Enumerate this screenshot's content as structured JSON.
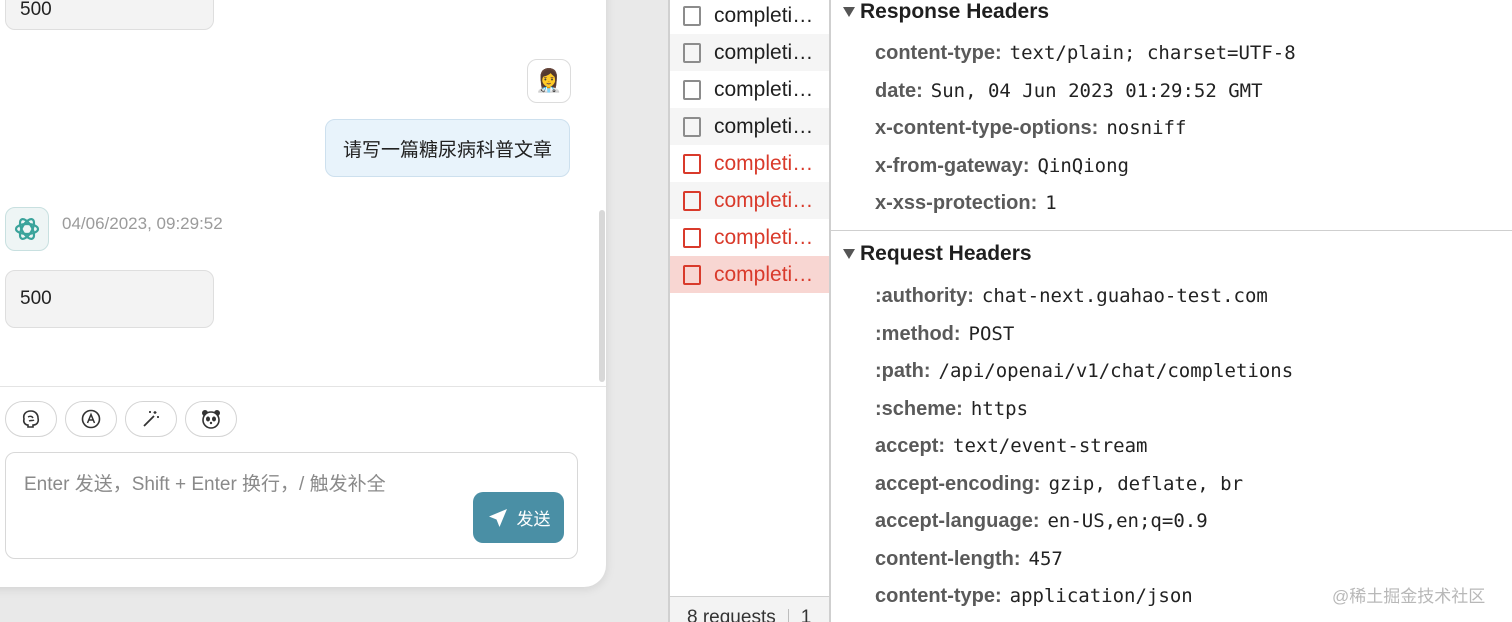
{
  "chat": {
    "top_bubble_text": "500",
    "user_avatar_emoji": "👩‍⚕️",
    "user_message": "请写一篇糖尿病科普文章",
    "bot_timestamp": "04/06/2023, 09:29:52",
    "bot_reply": "500",
    "toolbar": [
      {
        "icon": "brain-icon"
      },
      {
        "icon": "auto-icon"
      },
      {
        "icon": "magic-wand-icon"
      },
      {
        "icon": "panda-icon"
      }
    ],
    "input_placeholder": "Enter 发送，Shift + Enter 换行，/ 触发补全",
    "send_label": "发送",
    "colors": {
      "accent": "#4a8fa5",
      "user_bubble": "#e8f3fb"
    }
  },
  "network": {
    "requests": [
      {
        "name": "completi…",
        "status": "ok"
      },
      {
        "name": "completi…",
        "status": "ok"
      },
      {
        "name": "completi…",
        "status": "ok"
      },
      {
        "name": "completi…",
        "status": "ok"
      },
      {
        "name": "completi…",
        "status": "error"
      },
      {
        "name": "completi…",
        "status": "error"
      },
      {
        "name": "completi…",
        "status": "error"
      },
      {
        "name": "completi…",
        "status": "error",
        "selected": true
      }
    ],
    "footer": {
      "count": "8 requests",
      "extra": "1"
    },
    "colors": {
      "error": "#d93a2b",
      "selected_bg": "#f8d6d2"
    }
  },
  "headers": {
    "response_title": "Response Headers",
    "response": [
      {
        "name": "content-type:",
        "value": "text/plain; charset=UTF-8"
      },
      {
        "name": "date:",
        "value": "Sun, 04 Jun 2023 01:29:52 GMT"
      },
      {
        "name": "x-content-type-options:",
        "value": "nosniff"
      },
      {
        "name": "x-from-gateway:",
        "value": "QinQiong"
      },
      {
        "name": "x-xss-protection:",
        "value": "1"
      }
    ],
    "request_title": "Request Headers",
    "request": [
      {
        "name": ":authority:",
        "value": "chat-next.guahao-test.com"
      },
      {
        "name": ":method:",
        "value": "POST"
      },
      {
        "name": ":path:",
        "value": "/api/openai/v1/chat/completions"
      },
      {
        "name": ":scheme:",
        "value": "https"
      },
      {
        "name": "accept:",
        "value": "text/event-stream"
      },
      {
        "name": "accept-encoding:",
        "value": "gzip, deflate, br"
      },
      {
        "name": "accept-language:",
        "value": "en-US,en;q=0.9"
      },
      {
        "name": "content-length:",
        "value": "457"
      },
      {
        "name": "content-type:",
        "value": "application/json"
      }
    ]
  },
  "watermark": "@稀土掘金技术社区"
}
